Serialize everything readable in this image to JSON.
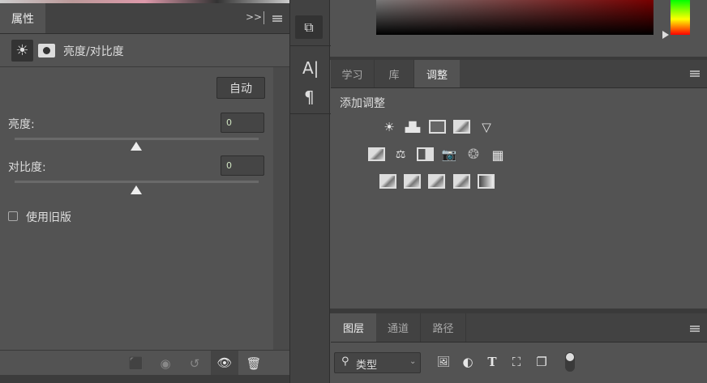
{
  "properties_panel": {
    "tab": "属性",
    "title": "亮度/对比度",
    "auto_button": "自动",
    "brightness_label": "亮度:",
    "brightness_value": "0",
    "brightness_slider_fraction": 0.5,
    "contrast_label": "对比度:",
    "contrast_value": "0",
    "contrast_slider_fraction": 0.5,
    "legacy_label": "使用旧版",
    "legacy_checked": false
  },
  "adjustments_panel": {
    "tabs": [
      "学习",
      "库",
      "调整"
    ],
    "active_tab": "调整",
    "heading": "添加调整"
  },
  "layers_panel": {
    "tabs": [
      "图层",
      "通道",
      "路径"
    ],
    "active_tab": "图层",
    "filter_value": "类型"
  }
}
